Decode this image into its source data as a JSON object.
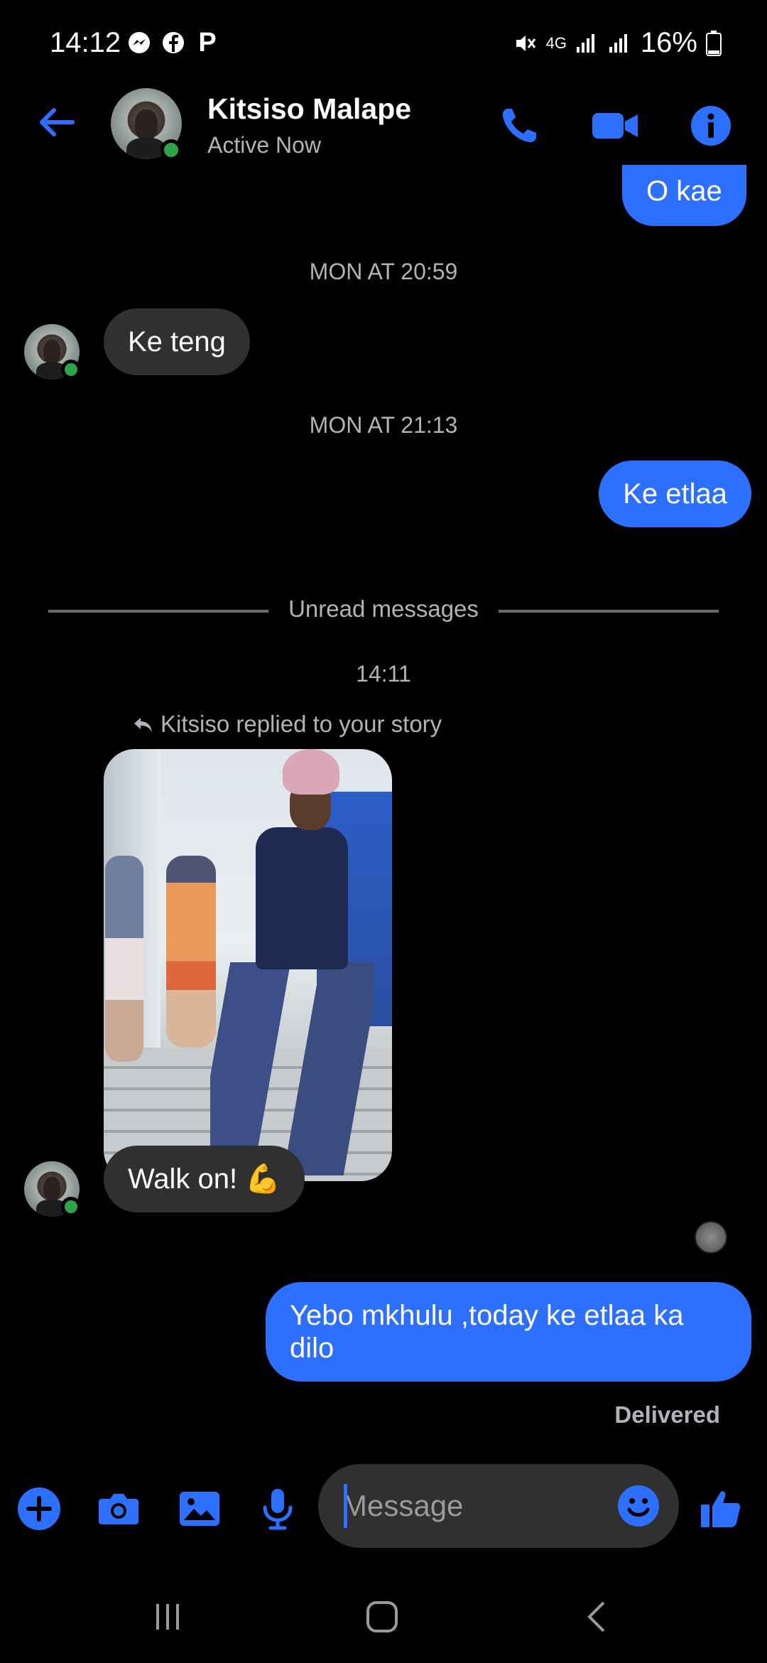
{
  "status_bar": {
    "time": "14:12",
    "network": "4G",
    "battery": "16%"
  },
  "header": {
    "contact_name": "Kitsiso Malape",
    "contact_status": "Active Now"
  },
  "colors": {
    "accent": "#2d6fff",
    "incoming_bubble": "#303030",
    "online": "#31a24c",
    "muted_text": "#b0b3b8"
  },
  "conversation": {
    "msg_top_out": "O kae",
    "timestamp_1": "MON AT 20:59",
    "msg_in_1": "Ke teng",
    "timestamp_2": "MON AT 21:13",
    "msg_out_1": "Ke etlaa",
    "unread_divider": "Unread messages",
    "timestamp_3": "14:11",
    "story_reply_text": "Kitsiso replied to your story",
    "msg_in_2": "Walk on! 💪",
    "msg_out_2": "Yebo mkhulu ,today ke etlaa ka dilo",
    "delivered_label": "Delivered"
  },
  "composer": {
    "placeholder": "Message"
  },
  "icons": {
    "back": "arrow-left-icon",
    "call": "phone-icon",
    "video": "video-camera-icon",
    "info": "info-icon",
    "add": "plus-icon",
    "camera": "camera-icon",
    "gallery": "image-icon",
    "mic": "microphone-icon",
    "emoji": "smiley-icon",
    "like": "thumbs-up-icon"
  }
}
